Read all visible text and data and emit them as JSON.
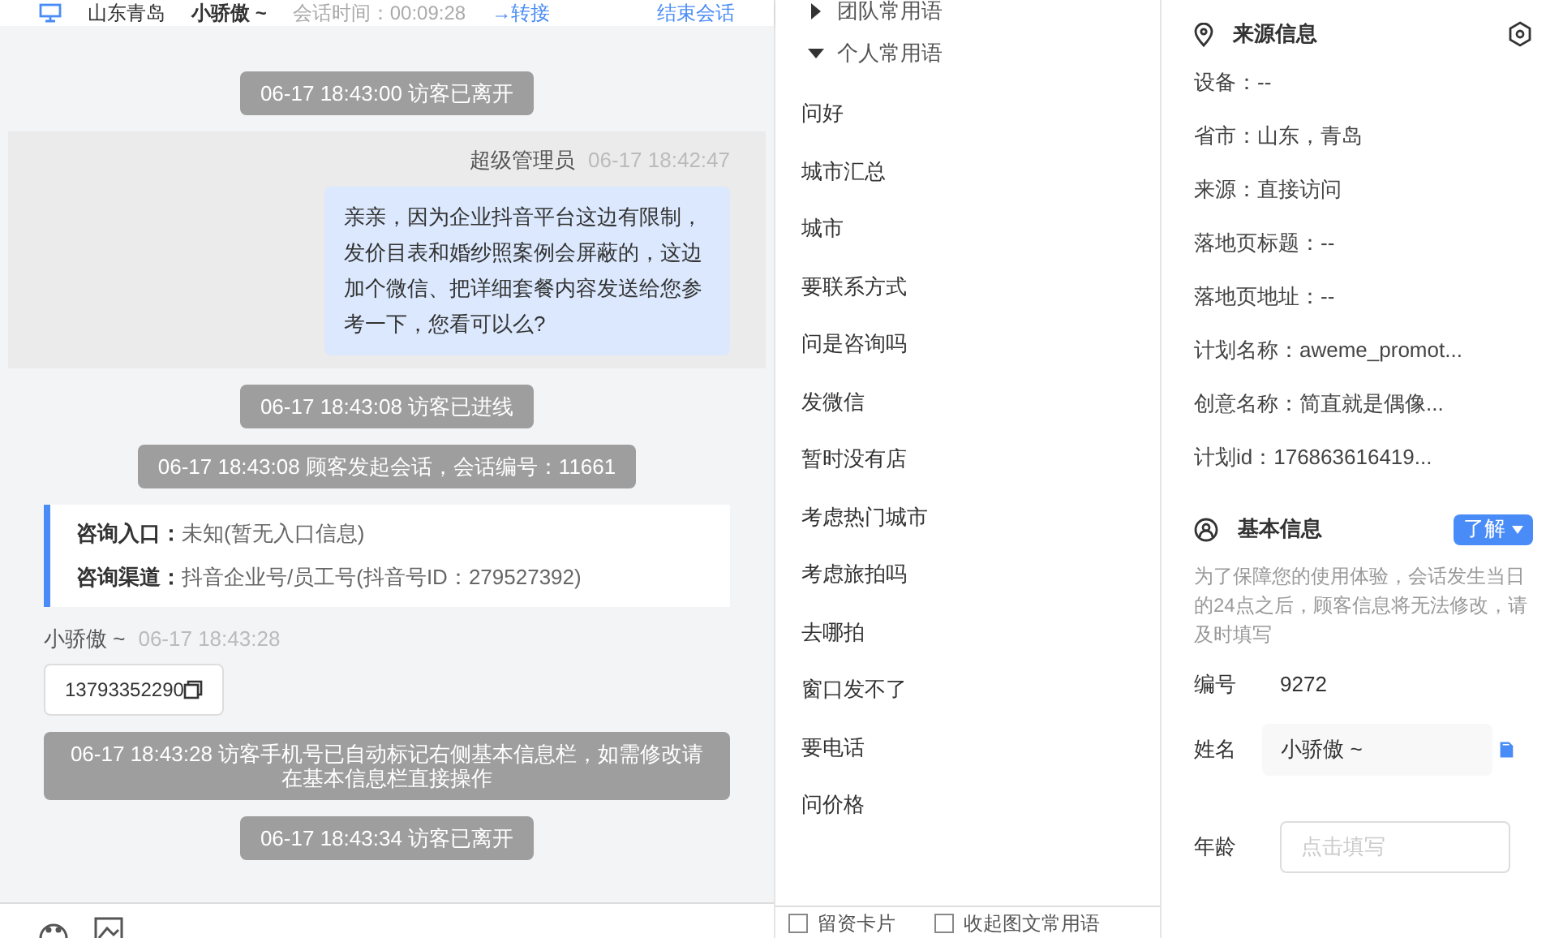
{
  "header": {
    "location": "山东青岛",
    "visitor": "小骄傲 ~",
    "duration": "会话时间：00:09:28",
    "transfer": "→转接",
    "end": "结束会话"
  },
  "messages": [
    {
      "kind": "system",
      "text": "06-17 18:43:00 访客已离开"
    },
    {
      "kind": "agent",
      "sender": "超级管理员",
      "time": "06-17 18:42:47",
      "text": "亲亲，因为企业抖音平台这边有限制，发价目表和婚纱照案例会屏蔽的，这边加个微信、把详细套餐内容发送给您参考一下，您看可以么?"
    },
    {
      "kind": "system",
      "text": "06-17 18:43:08 访客已进线"
    },
    {
      "kind": "system",
      "text": "06-17 18:43:08 顾客发起会话，会话编号：11661"
    },
    {
      "kind": "info",
      "rows": [
        {
          "label": "咨询入口：",
          "value": "未知(暂无入口信息)"
        },
        {
          "label": "咨询渠道：",
          "value": "抖音企业号/员工号(抖音号ID：279527392)"
        }
      ]
    },
    {
      "kind": "visitor",
      "sender": "小骄傲 ~",
      "time": "06-17 18:43:28",
      "text": "13793352290"
    },
    {
      "kind": "notice",
      "text": "06-17 18:43:28 访客手机号已自动标记右侧基本信息栏，如需修改请在基本信息栏直接操作"
    },
    {
      "kind": "system",
      "text": "06-17 18:43:34 访客已离开"
    }
  ],
  "phrases": {
    "groups": [
      {
        "title": "团队常用语",
        "expanded": false
      },
      {
        "title": "个人常用语",
        "expanded": true,
        "items": [
          "问好",
          "城市汇总",
          "城市",
          "要联系方式",
          "问是咨询吗",
          "发微信",
          "暂时没有店",
          "考虑热门城市",
          "考虑旅拍吗",
          "去哪拍",
          "窗口发不了",
          "要电话",
          "问价格"
        ]
      }
    ],
    "options": [
      {
        "label": "留资卡片",
        "checked": false
      },
      {
        "label": "收起图文常用语",
        "checked": false
      }
    ]
  },
  "source_info": {
    "title": "来源信息",
    "fields": [
      "设备：--",
      "省市：山东，青岛",
      "来源：直接访问",
      "落地页标题：--",
      "落地页地址：--",
      "计划名称：aweme_promot...",
      "创意名称：简直就是偶像...",
      "计划id：176863616419..."
    ]
  },
  "basic_info": {
    "title": "基本信息",
    "menu": "了解",
    "notice": "为了保障您的使用体验，会话发生当日的24点之后，顾客信息将无法修改，请及时填写",
    "id_label": "编号",
    "id_value": "9272",
    "name_label": "姓名",
    "name_value": "小骄傲 ~",
    "age_label": "年龄",
    "age_placeholder": "点击填写"
  }
}
